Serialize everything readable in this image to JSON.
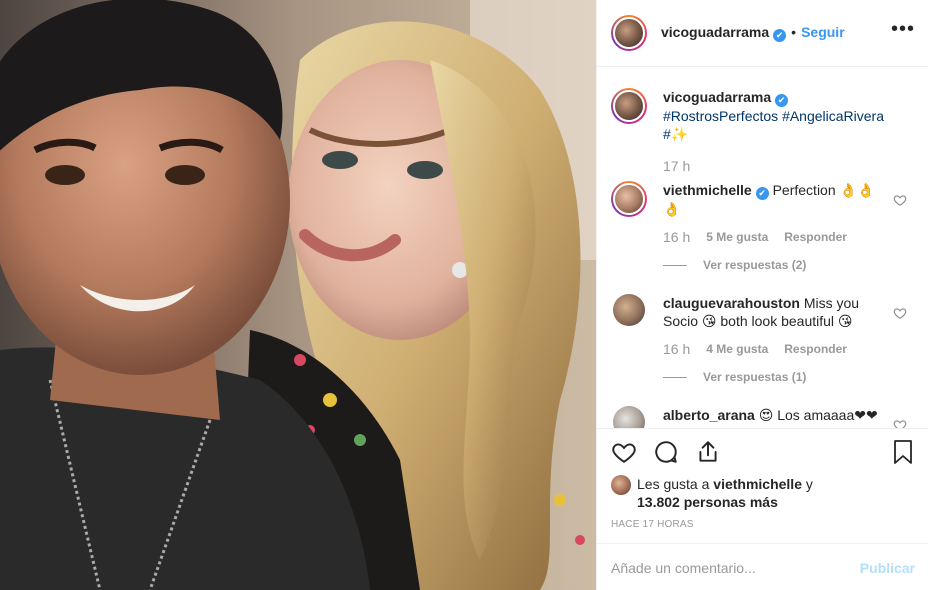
{
  "colors": {
    "accent": "#3897f0",
    "muted": "#999999",
    "publish_disabled": "#b2dffc",
    "text": "#262626"
  },
  "header": {
    "username": "vicoguadarrama",
    "verified": "✔",
    "separator": "•",
    "follow": "Seguir",
    "more_icon": "more-options-icon"
  },
  "caption": {
    "username": "vicoguadarrama",
    "tag1": "#RostrosPerfectos",
    "tag2": "#AngelicaRivera",
    "tag_suffix": "#✨",
    "time": "17 h"
  },
  "comments": [
    {
      "username": "viethmichelle",
      "text": "Perfection 👌👌👌",
      "time": "16 h",
      "likes": "5 Me gusta",
      "reply": "Responder",
      "replies": "Ver respuestas (2)"
    },
    {
      "username": "clauguevarahouston",
      "text": "Miss you Socio 😘 both look beautiful 😘",
      "time": "16 h",
      "likes": "4 Me gusta",
      "reply": "Responder",
      "replies": "Ver respuestas (1)"
    },
    {
      "username": "alberto_arana",
      "text": "😍 Los amaaaa❤❤❤❤"
    }
  ],
  "likes_line1": "Les gusta a ",
  "likes_user": "viethmichelle",
  "likes_y": " y",
  "likes_count": "13.802 personas más",
  "timestamp": "HACE 17 HORAS",
  "comment_placeholder": "Añade un comentario...",
  "publish": "Publicar"
}
